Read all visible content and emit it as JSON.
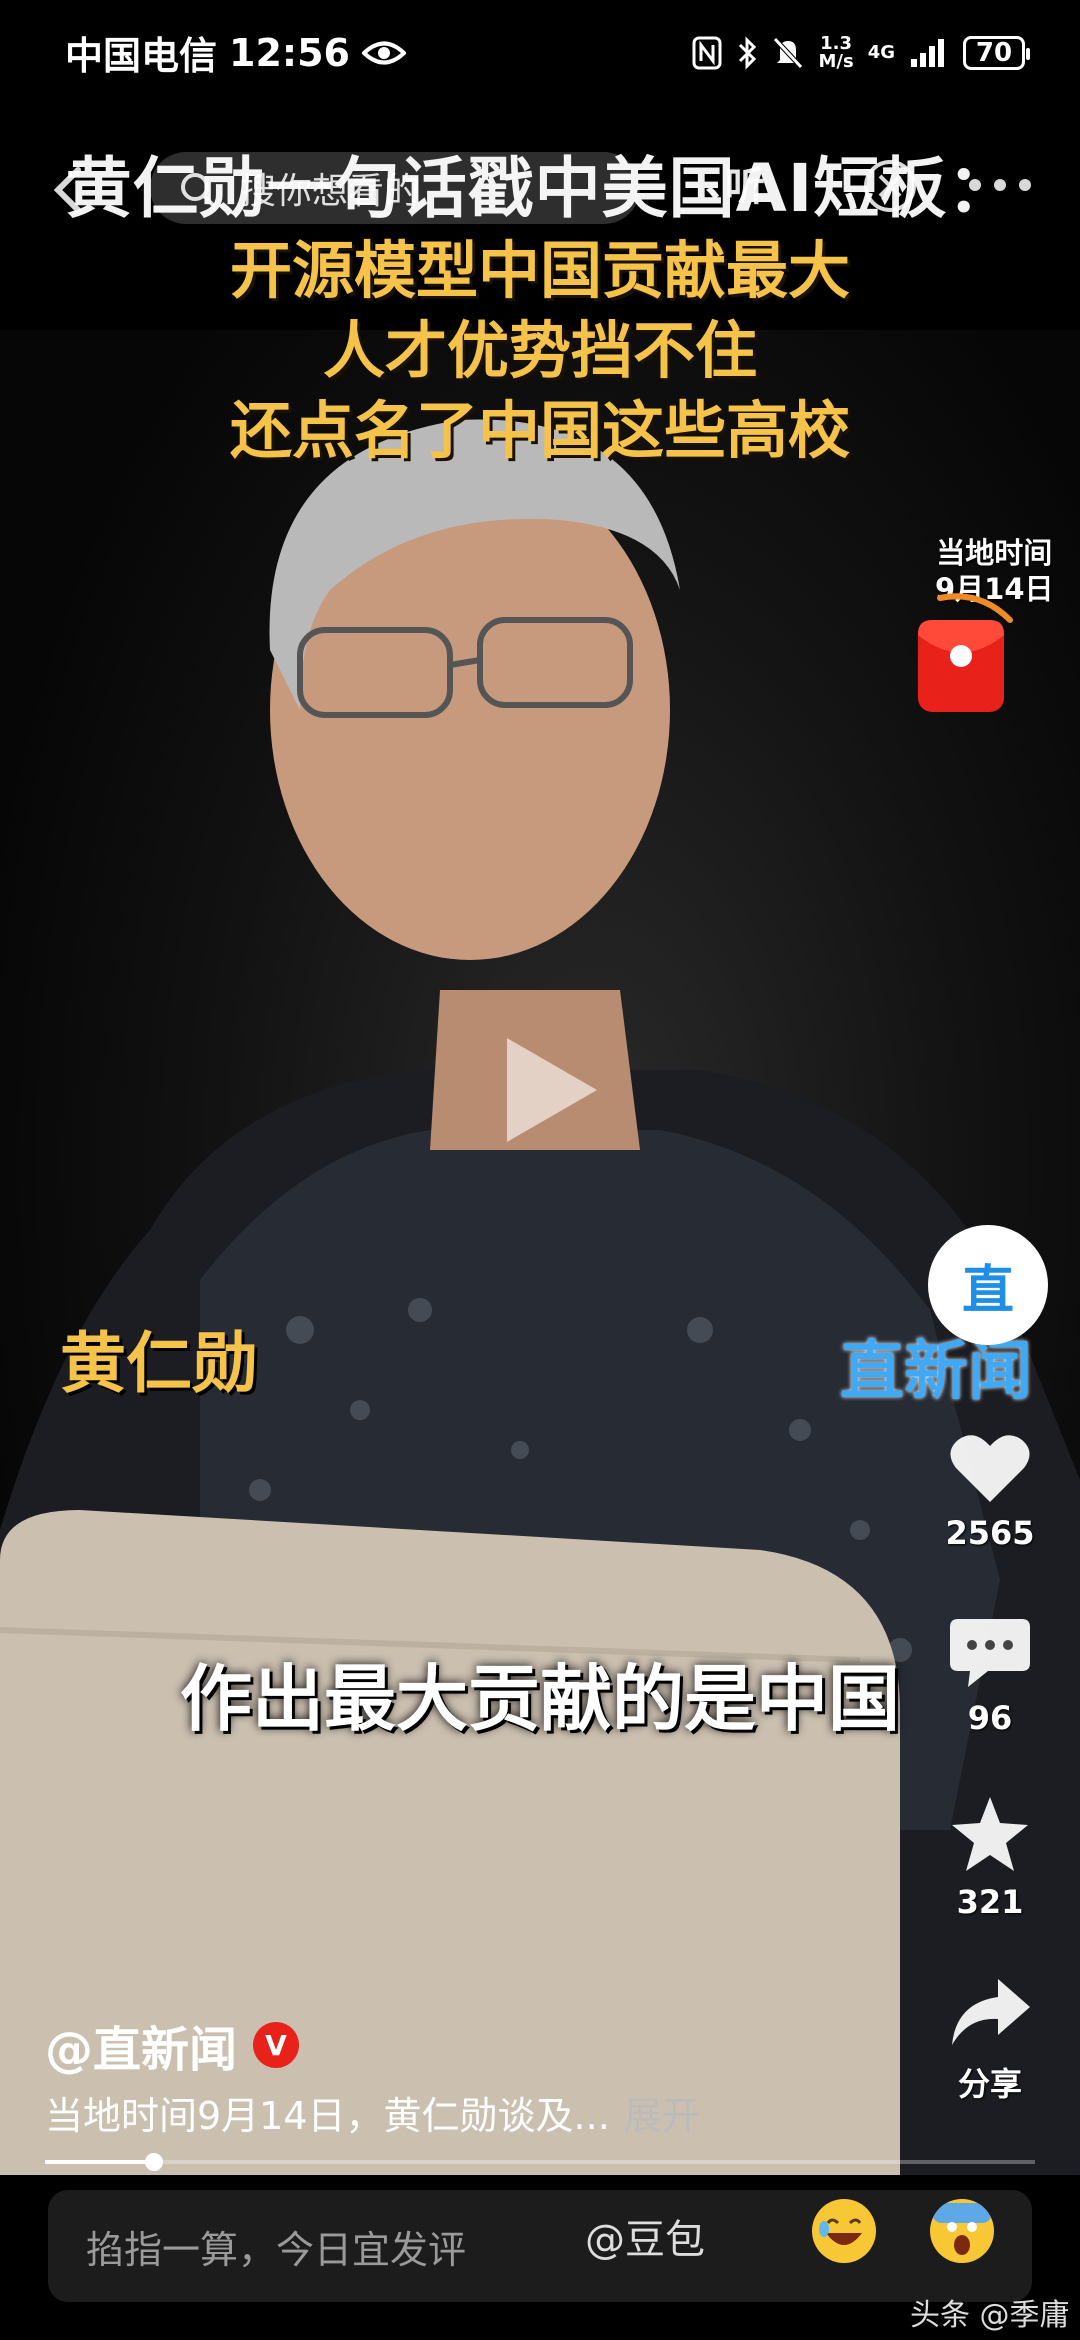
{
  "status_bar": {
    "carrier": "中国电信",
    "time": "12:56",
    "net_speed_value": "1.3",
    "net_speed_unit": "M/s",
    "network": "4G",
    "battery": "70"
  },
  "top_nav": {
    "search_placeholder": "搜你想看的",
    "listen_label": "听"
  },
  "headline": {
    "line1": "黄仁勋一句话戳中美国AI短板：",
    "line2": "开源模型中国贡献最大",
    "line3": "人才优势挡不住",
    "line4": "还点名了中国这些高校"
  },
  "video": {
    "time_tag_line1": "当地时间",
    "time_tag_line2": "9月14日",
    "name_caption": "黄仁勋",
    "watermark": "直新闻",
    "subtitle": "作出最大贡献的是中国"
  },
  "rail": {
    "avatar_text": "直",
    "likes": "2565",
    "comments": "96",
    "favorites": "321",
    "share_label": "分享"
  },
  "post": {
    "author": "@直新闻",
    "verified_badge": "V",
    "description": "当地时间9月14日，黄仁勋谈及...",
    "expand_label": "展开",
    "progress": 0.11
  },
  "comment_bar": {
    "placeholder": "掐指一算，今日宜发评",
    "mention": "@豆包"
  },
  "footer_tag": "头条 @季庸",
  "colors": {
    "headline_yellow": "#f5c24a",
    "watermark_blue": "#3fa9f5",
    "badge_red": "#e8211b"
  }
}
